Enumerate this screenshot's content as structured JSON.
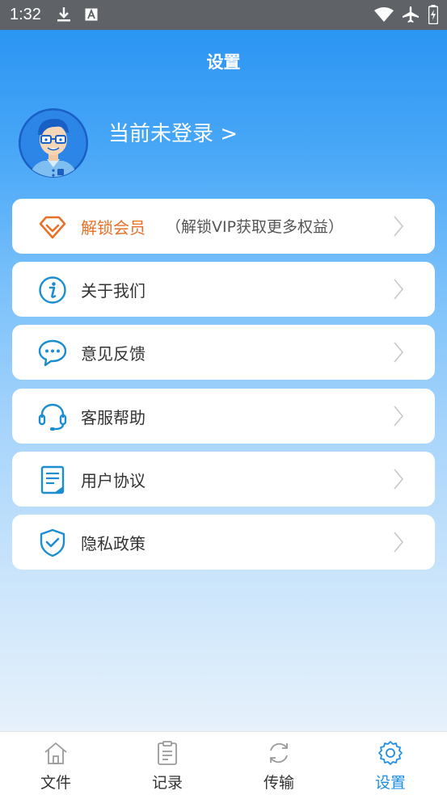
{
  "status_bar": {
    "time": "1:32",
    "icons": [
      "download-icon",
      "a-box-icon",
      "wifi-icon",
      "airplane-icon",
      "battery-charging-icon"
    ]
  },
  "header": {
    "title": "设置"
  },
  "profile": {
    "login_text": "当前未登录 >"
  },
  "menu": {
    "items": [
      {
        "label": "解锁会员",
        "note": "（解锁VIP获取更多权益）",
        "icon": "diamond-icon",
        "accent": "#e8712a"
      },
      {
        "label": "关于我们",
        "icon": "info-icon"
      },
      {
        "label": "意见反馈",
        "icon": "chat-bubble-icon"
      },
      {
        "label": "客服帮助",
        "icon": "headset-icon"
      },
      {
        "label": "用户协议",
        "icon": "document-icon"
      },
      {
        "label": "隐私政策",
        "icon": "shield-check-icon"
      }
    ]
  },
  "tabbar": {
    "active": "设置",
    "items": [
      {
        "label": "文件",
        "icon": "home-icon"
      },
      {
        "label": "记录",
        "icon": "clipboard-icon"
      },
      {
        "label": "传输",
        "icon": "sync-icon"
      },
      {
        "label": "设置",
        "icon": "gear-icon"
      }
    ]
  },
  "colors": {
    "accent": "#1e8fe8",
    "vip": "#e8712a",
    "icon_blue": "#1b8ed1"
  }
}
